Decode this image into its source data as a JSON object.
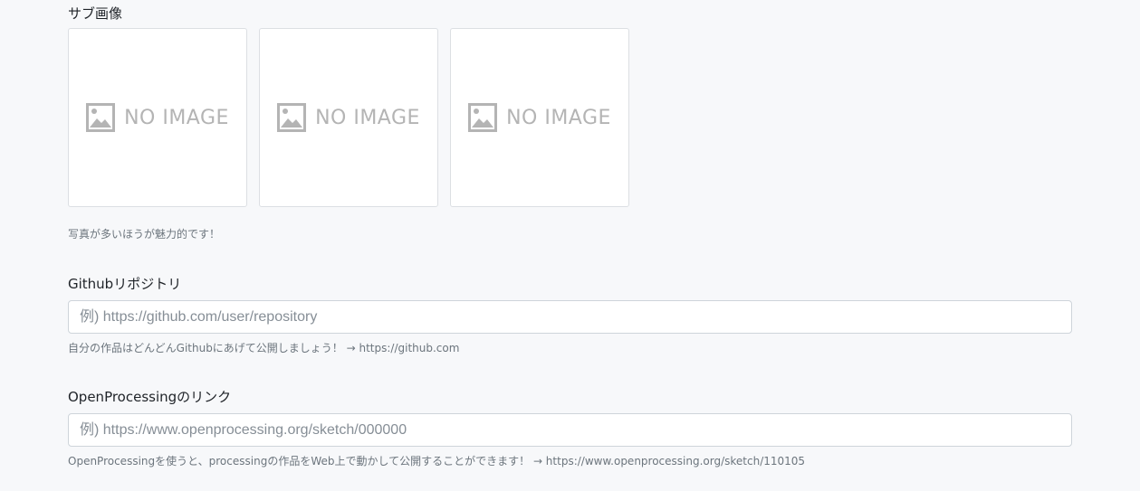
{
  "sub_image": {
    "label": "サブ画像",
    "placeholder_text": "NO IMAGE",
    "slots": [
      {
        "icon": "image-placeholder-icon"
      },
      {
        "icon": "image-placeholder-icon"
      },
      {
        "icon": "image-placeholder-icon"
      }
    ],
    "help": "写真が多いほうが魅力的です！"
  },
  "github": {
    "label": "Githubリポジトリ",
    "placeholder": "例) https://github.com/user/repository",
    "value": "",
    "help": "自分の作品はどんどんGithubにあげて公開しましょう！ → https://github.com"
  },
  "openprocessing": {
    "label": "OpenProcessingのリンク",
    "placeholder": "例) https://www.openprocessing.org/sketch/000000",
    "value": "",
    "help": "OpenProcessingを使うと、processingの作品をWeb上で動かして公開することができます！ → https://www.openprocessing.org/sketch/110105"
  },
  "colors": {
    "background": "#f7f8fa",
    "input_border": "#ced4da",
    "help_text": "#6c757d",
    "placeholder_gray": "#b4b4b4"
  }
}
